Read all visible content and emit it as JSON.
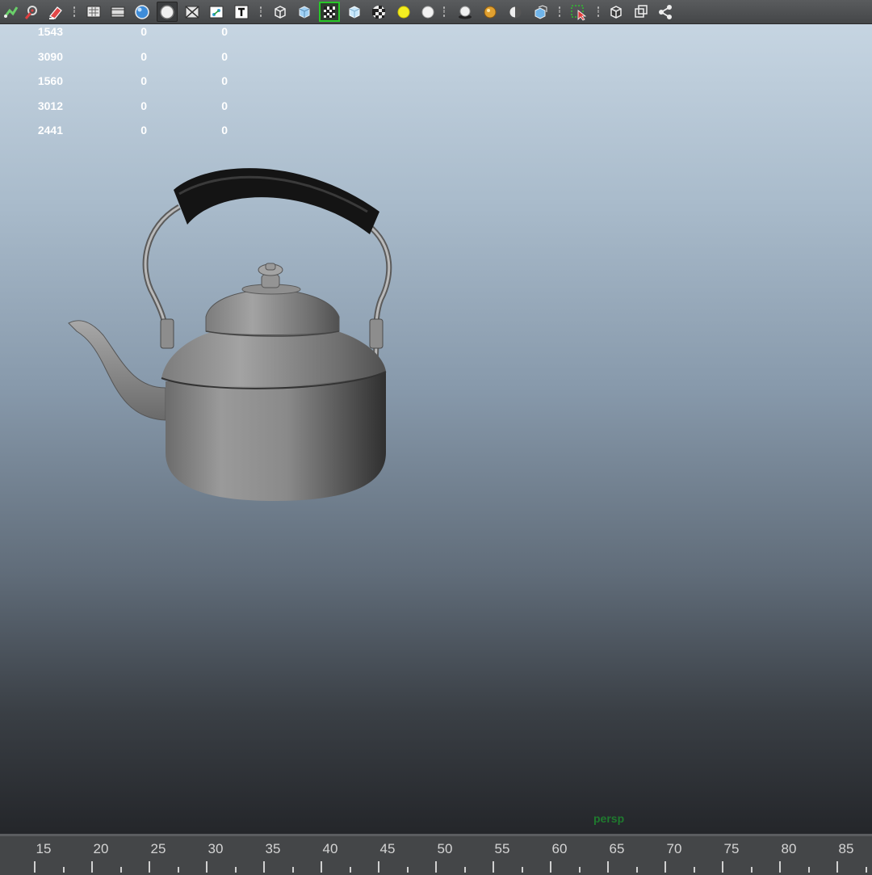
{
  "toolbar": {
    "buttons": [
      {
        "name": "snap-curve-icon"
      },
      {
        "name": "snap-point-icon"
      },
      {
        "name": "eraser-icon"
      },
      {
        "name": "wireframe-icon"
      },
      {
        "name": "film-gate-icon"
      },
      {
        "name": "shaded-sphere-icon"
      },
      {
        "name": "smooth-sphere-icon"
      },
      {
        "name": "resolution-gate-icon"
      },
      {
        "name": "uv-grid-icon"
      },
      {
        "name": "text-icon"
      },
      {
        "name": "wireframe-cube-icon"
      },
      {
        "name": "shaded-cube-icon"
      },
      {
        "name": "checker-selected-icon"
      },
      {
        "name": "textured-cube-icon"
      },
      {
        "name": "checker-icon"
      },
      {
        "name": "light-bulb-icon"
      },
      {
        "name": "white-sphere-icon"
      },
      {
        "name": "shadow-sphere-icon"
      },
      {
        "name": "gold-sphere-icon"
      },
      {
        "name": "half-sphere-icon"
      },
      {
        "name": "blue-cube-icon"
      },
      {
        "name": "isolate-select-icon"
      },
      {
        "name": "xray-cube-icon"
      },
      {
        "name": "xray-joints-icon"
      },
      {
        "name": "share-node-icon"
      }
    ],
    "pressed_index": 6,
    "selected_index": 12
  },
  "hud": {
    "rows": [
      [
        "1543",
        "0",
        "0"
      ],
      [
        "3090",
        "0",
        "0"
      ],
      [
        "1560",
        "0",
        "0"
      ],
      [
        "3012",
        "0",
        "0"
      ],
      [
        "2441",
        "0",
        "0"
      ]
    ]
  },
  "viewport": {
    "camera": "persp"
  },
  "timeline": {
    "labels": [
      "15",
      "20",
      "25",
      "30",
      "35",
      "40",
      "45",
      "50",
      "55",
      "60",
      "65",
      "70",
      "75",
      "80",
      "85"
    ]
  }
}
